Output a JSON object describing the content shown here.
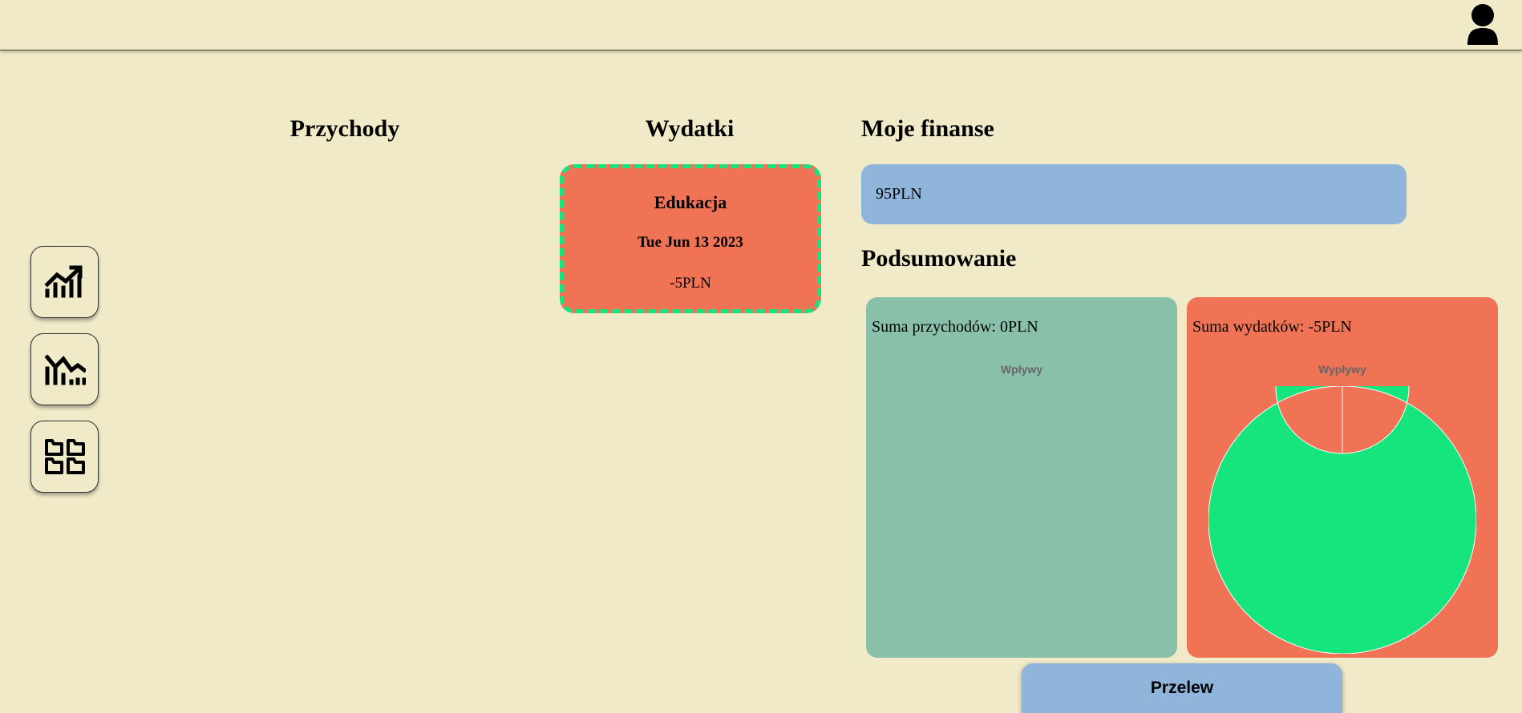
{
  "header": {
    "avatar_icon": "user-avatar-icon"
  },
  "sidebar": {
    "buttons": [
      {
        "icon": "income-chart-icon"
      },
      {
        "icon": "expense-chart-icon"
      },
      {
        "icon": "categories-folders-icon"
      }
    ]
  },
  "income": {
    "title": "Przychody"
  },
  "expenses": {
    "title": "Wydatki",
    "items": [
      {
        "category": "Edukacja",
        "date": "Tue Jun 13 2023",
        "amount": "-5PLN"
      }
    ]
  },
  "finances": {
    "title": "Moje finanse",
    "balance": "95PLN"
  },
  "summary": {
    "title": "Podsumowanie",
    "income_sum": "Suma przychodów: 0PLN",
    "expense_sum": "Suma wydatków: -5PLN",
    "income_chart_title": "Wpływy",
    "expense_chart_title": "Wypływy"
  },
  "actions": {
    "transfer_label": "Przelew"
  },
  "colors": {
    "background": "#f1eac8",
    "expense": "#f07356",
    "income": "#89c0aa",
    "accent_blue": "#8fb5da",
    "chart_green": "#16e57d"
  },
  "chart_data": [
    {
      "type": "pie",
      "title": "Wpływy",
      "categories": [],
      "values": []
    },
    {
      "type": "pie",
      "title": "Wypływy",
      "categories": [
        "Edukacja"
      ],
      "values": [
        5
      ]
    }
  ]
}
